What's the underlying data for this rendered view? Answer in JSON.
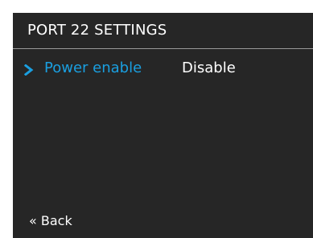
{
  "header": {
    "title": "PORT 22 SETTINGS"
  },
  "settings": [
    {
      "label": "Power enable",
      "value": "Disable",
      "selected": true
    }
  ],
  "footer": {
    "back_label": "« Back"
  },
  "colors": {
    "background": "#262626",
    "highlight": "#1a9fe0",
    "text": "#ffffff",
    "divider": "#9a9a9a"
  },
  "icons": {
    "selection": "chevron-right-icon"
  }
}
